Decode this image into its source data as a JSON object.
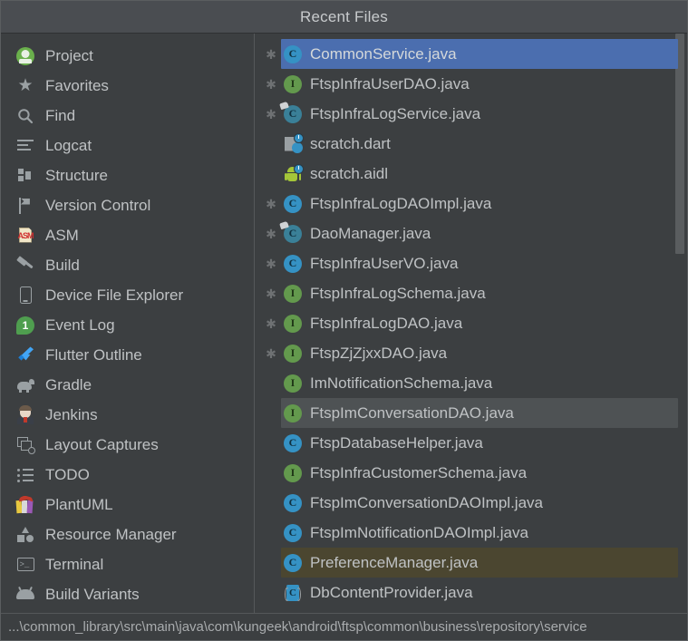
{
  "window": {
    "title": "Recent Files"
  },
  "sidebar": {
    "items": [
      {
        "label": "Project",
        "icon": "android-studio-icon"
      },
      {
        "label": "Favorites",
        "icon": "star-icon"
      },
      {
        "label": "Find",
        "icon": "search-icon"
      },
      {
        "label": "Logcat",
        "icon": "logcat-icon"
      },
      {
        "label": "Structure",
        "icon": "structure-icon"
      },
      {
        "label": "Version Control",
        "icon": "version-control-icon"
      },
      {
        "label": "ASM",
        "icon": "asm-icon"
      },
      {
        "label": "Build",
        "icon": "hammer-icon"
      },
      {
        "label": "Device File Explorer",
        "icon": "phone-icon"
      },
      {
        "label": "Event Log",
        "icon": "event-log-badge-icon",
        "badge": "1"
      },
      {
        "label": "Flutter Outline",
        "icon": "flutter-icon"
      },
      {
        "label": "Gradle",
        "icon": "gradle-elephant-icon"
      },
      {
        "label": "Jenkins",
        "icon": "jenkins-butler-icon"
      },
      {
        "label": "Layout Captures",
        "icon": "layout-captures-icon"
      },
      {
        "label": "TODO",
        "icon": "todo-list-icon"
      },
      {
        "label": "PlantUML",
        "icon": "plantuml-books-icon"
      },
      {
        "label": "Resource Manager",
        "icon": "resource-manager-icon"
      },
      {
        "label": "Terminal",
        "icon": "terminal-icon"
      },
      {
        "label": "Build Variants",
        "icon": "android-head-icon"
      }
    ]
  },
  "files": {
    "items": [
      {
        "name": "CommonService.java",
        "icon": "java-class-icon",
        "star": true,
        "state": "selected"
      },
      {
        "name": "FtspInfraUserDAO.java",
        "icon": "java-interface-icon",
        "star": true,
        "state": "normal"
      },
      {
        "name": "FtspInfraLogService.java",
        "icon": "java-abstract-class-icon",
        "star": true,
        "state": "normal"
      },
      {
        "name": "scratch.dart",
        "icon": "scratch-dart-icon",
        "star": false,
        "state": "normal"
      },
      {
        "name": "scratch.aidl",
        "icon": "scratch-aidl-icon",
        "star": false,
        "state": "normal"
      },
      {
        "name": "FtspInfraLogDAOImpl.java",
        "icon": "java-class-icon",
        "star": true,
        "state": "normal"
      },
      {
        "name": "DaoManager.java",
        "icon": "java-abstract-class-icon",
        "star": true,
        "state": "normal"
      },
      {
        "name": "FtspInfraUserVO.java",
        "icon": "java-class-icon",
        "star": true,
        "state": "normal"
      },
      {
        "name": "FtspInfraLogSchema.java",
        "icon": "java-interface-icon",
        "star": true,
        "state": "normal"
      },
      {
        "name": "FtspInfraLogDAO.java",
        "icon": "java-interface-icon",
        "star": true,
        "state": "normal"
      },
      {
        "name": "FtspZjZjxxDAO.java",
        "icon": "java-interface-icon",
        "star": true,
        "state": "normal"
      },
      {
        "name": "ImNotificationSchema.java",
        "icon": "java-interface-icon",
        "star": false,
        "state": "normal"
      },
      {
        "name": "FtspImConversationDAO.java",
        "icon": "java-interface-icon",
        "star": false,
        "state": "hover"
      },
      {
        "name": "FtspDatabaseHelper.java",
        "icon": "java-class-icon",
        "star": false,
        "state": "normal"
      },
      {
        "name": "FtspInfraCustomerSchema.java",
        "icon": "java-interface-icon",
        "star": false,
        "state": "normal"
      },
      {
        "name": "FtspImConversationDAOImpl.java",
        "icon": "java-class-icon",
        "star": false,
        "state": "normal"
      },
      {
        "name": "FtspImNotificationDAOImpl.java",
        "icon": "java-class-icon",
        "star": false,
        "state": "normal"
      },
      {
        "name": "PreferenceManager.java",
        "icon": "java-class-icon",
        "star": false,
        "state": "bookmark"
      },
      {
        "name": "DbContentProvider.java",
        "icon": "java-provider-icon",
        "star": false,
        "state": "normal"
      }
    ]
  },
  "statusbar": {
    "path": "...\\common_library\\src\\main\\java\\com\\kungeek\\android\\ftsp\\common\\business\\repository\\service"
  },
  "colors": {
    "selection": "#4b6eaf",
    "hover": "#4e5254",
    "bookmark": "#4b4630",
    "class_icon": "#3592c4",
    "interface_icon": "#63994d",
    "titlebar": "#4a4d51",
    "background": "#3c3f41",
    "text": "#bfc2c4"
  },
  "scrollbar": {
    "thumb_top_pct": 0,
    "thumb_height_pct": 38
  }
}
